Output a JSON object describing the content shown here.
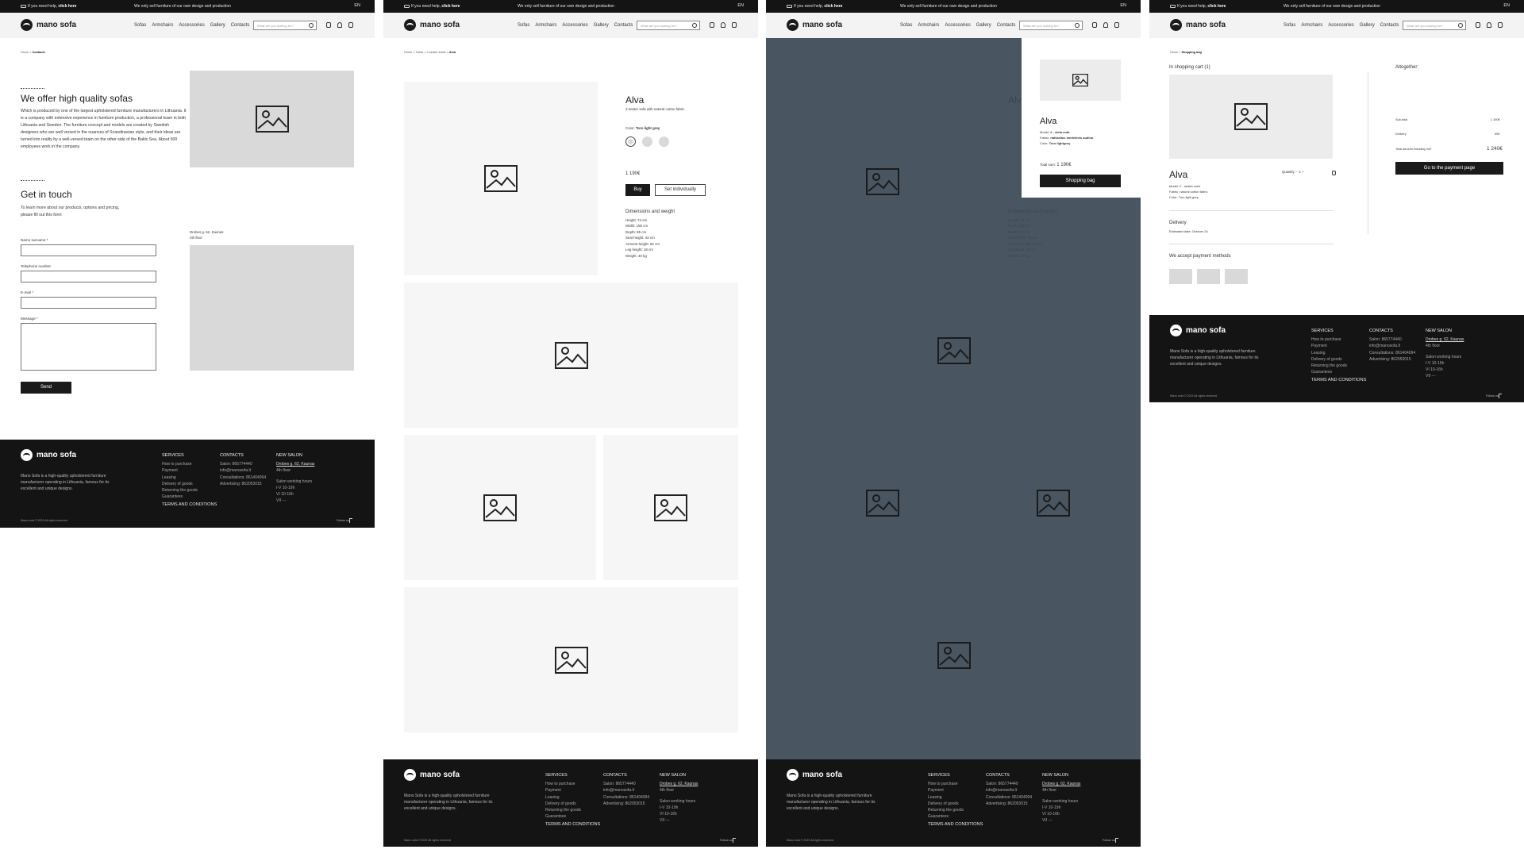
{
  "common": {
    "help_prefix": "If you need help,",
    "help_link": "click here",
    "promo": "We only sell furniture of our own design and production",
    "lang": "EN",
    "brand": "mano sofa",
    "nav": [
      "Sofas",
      "Armchairs",
      "Accessories",
      "Gallery",
      "Contacts"
    ],
    "search_placeholder": "What are you looking for?"
  },
  "footer": {
    "description": "Mano Sofa is a high-quality upholstered furniture manufacturer operating in Lithuania, famous for its excellent and unique designs.",
    "services_title": "SERVICES",
    "services": [
      "How to purchase",
      "Payment",
      "Leasing",
      "Delivery of goods",
      "Returning the goods",
      "Guarantees"
    ],
    "contacts_title": "CONTACTS",
    "contacts": [
      "Salon: 865774440",
      "info@manosofa.lt",
      "Consultations: 861404094",
      "Advertising: 862053015"
    ],
    "salon_title": "NEW SALON",
    "salon_address": "Drobes g. 62, Kaunas",
    "salon_floor": "4th floor",
    "hours_title": "Salon working hours",
    "hours": [
      "I-V 10-19h",
      "VI 10-16h",
      "VII ---"
    ],
    "terms": "TERMS AND CONDITIONS",
    "copyright": "Mano sofa © 2023 All rights reserved",
    "follow": "Follow us"
  },
  "contacts_page": {
    "breadcrumb_home": "Home",
    "breadcrumb_current": "Contacts",
    "about_title": "We offer high quality sofas",
    "about_text": "Which is produced by one of the largest upholstered furniture manufacturers in Lithuania. It is a company with extensive experience in furniture production, a professional team in both Lithuania and Sweden. The furniture concept and models are created by Swedish designers who are well versed in the nuances of Scandinavian style, and their ideas are turned into reality by a well-versed team on the other side of the Baltic Sea. About 500 employees work in the company.",
    "touch_title": "Get in touch",
    "touch_text": "To learn more about our products, options and pricing, please fill out this form",
    "label_name": "Name surname *",
    "label_phone": "Telephone number",
    "label_email": "E-mail *",
    "label_message": "Message *",
    "send": "Send",
    "address": "Drobes g. 62, Kaunas",
    "floor": "4th floor"
  },
  "product_page": {
    "breadcrumb": [
      "Home",
      "Sofas",
      "2-seater sofas",
      "Alva"
    ],
    "name": "Alva",
    "subtitle": "2-seater sofa with natural cotton fabric",
    "color_label": "Color:",
    "color_value": "Toro light grey",
    "price": "1 190€",
    "buy": "Buy",
    "set_individually": "Set individually",
    "dims_title": "Dimensions and weight",
    "dims": [
      "Height: 74 cm",
      "Width: 155 cm",
      "Depth: 85 cm",
      "Seat height: 43 cm",
      "Armrest height: 62 cm",
      "Leg height: 18 cm",
      "Weight: 40 kg"
    ]
  },
  "cart_popup": {
    "name": "Alva",
    "model_label": "Model:",
    "model_value": "2 - vieta sofa",
    "fabric_label": "Fabric:",
    "fabric_value": "natūralios medvilnės audinu",
    "color_label": "Color:",
    "color_value": "Toro lightgrey",
    "total_label": "Total sum:",
    "total_value": "1 190€",
    "button": "Shopping bag"
  },
  "cart_page": {
    "breadcrumb_home": "Home",
    "breadcrumb_current": "Shopping bag",
    "in_cart": "In shopping cart (1)",
    "item_name": "Alva",
    "quantity_label": "Quantity:",
    "quantity_value": "1",
    "model": "Model: 2 - seater sofa",
    "fabric": "Fabric: natural cotton fabric",
    "color": "Color: Toro light grey",
    "delivery_title": "Delivery",
    "delivery_est": "Estimated date: October 24",
    "payment_title": "We accept payment methods",
    "altogether": "Altogether:",
    "subtotal_label": "Sub-total",
    "subtotal_value": "1 190€",
    "delivery_label": "Delivery",
    "delivery_value": "50€",
    "total_label": "Total amount including VAT",
    "total_value": "1 240€",
    "pay_button": "Go to the payment page"
  },
  "colors": {
    "dark": "#141414",
    "placeholder": "#d9d9d9",
    "overlay": "#3a4854"
  }
}
